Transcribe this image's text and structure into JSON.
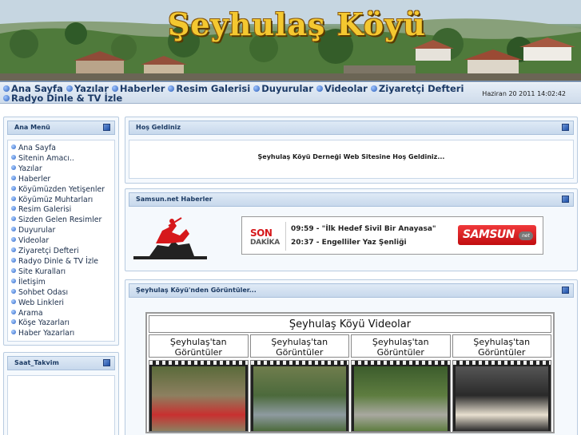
{
  "site": {
    "title": "Şeyhulaş  Köyü"
  },
  "nav": {
    "items": [
      "Ana Sayfa",
      "Yazılar",
      "Haberler",
      "Resim Galerisi",
      "Duyurular",
      "Videolar",
      "Ziyaretçi Defteri",
      "Radyo Dinle & TV İzle"
    ],
    "date": "Haziran 20 2011 14:02:42"
  },
  "main_menu": {
    "title": "Ana Menü",
    "items": [
      "Ana Sayfa",
      "Sitenin Amacı..",
      "Yazılar",
      "Haberler",
      "Köyümüzden Yetişenler",
      "Köyümüz Muhtarları",
      "Resim Galerisi",
      "Sizden Gelen Resimler",
      "Duyurular",
      "Videolar",
      "Ziyaretçi Defteri",
      "Radyo Dinle & TV İzle",
      "Site Kuralları",
      "İletişim",
      "Sohbet Odası",
      "Web Linkleri",
      "Arama",
      "Köşe Yazarları",
      "Haber Yazarları"
    ]
  },
  "clock_panel": {
    "title": "Saat_Takvim"
  },
  "welcome": {
    "title": "Hoş Geldiniz",
    "text": "Şeyhulaş Köyü Derneği Web Sitesine Hoş Geldiniz..."
  },
  "news": {
    "title": "Samsun.net Haberler",
    "son": "SON",
    "dakika": "DAKİKA",
    "items": [
      {
        "time": "09:59",
        "text": "\"İlk Hedef Sivil Bir Anayasa\""
      },
      {
        "time": "20:37",
        "text": "Engelliler Yaz Şenliği"
      }
    ],
    "logo": "SAMSUN",
    "logo_suffix": "net"
  },
  "videos": {
    "panel_title": "Şeyhulaş Köyü'nden Görüntüler...",
    "table_title": "Şeyhulaş Köyü Videolar",
    "columns": [
      {
        "line1": "Şeyhulaş'tan",
        "line2": "Görüntüler"
      },
      {
        "line1": "Şeyhulaş'tan",
        "line2": "Görüntüler"
      },
      {
        "line1": "Şeyhulaş'tan",
        "line2": "Görüntüler"
      },
      {
        "line1": "Şeyhulaş'tan",
        "line2": "Görüntüler"
      }
    ]
  },
  "colors": {
    "nav_text": "#1c3a66",
    "title_gold": "#f4c830",
    "panel_border": "#b8cbe0",
    "accent_red": "#d6181b"
  }
}
